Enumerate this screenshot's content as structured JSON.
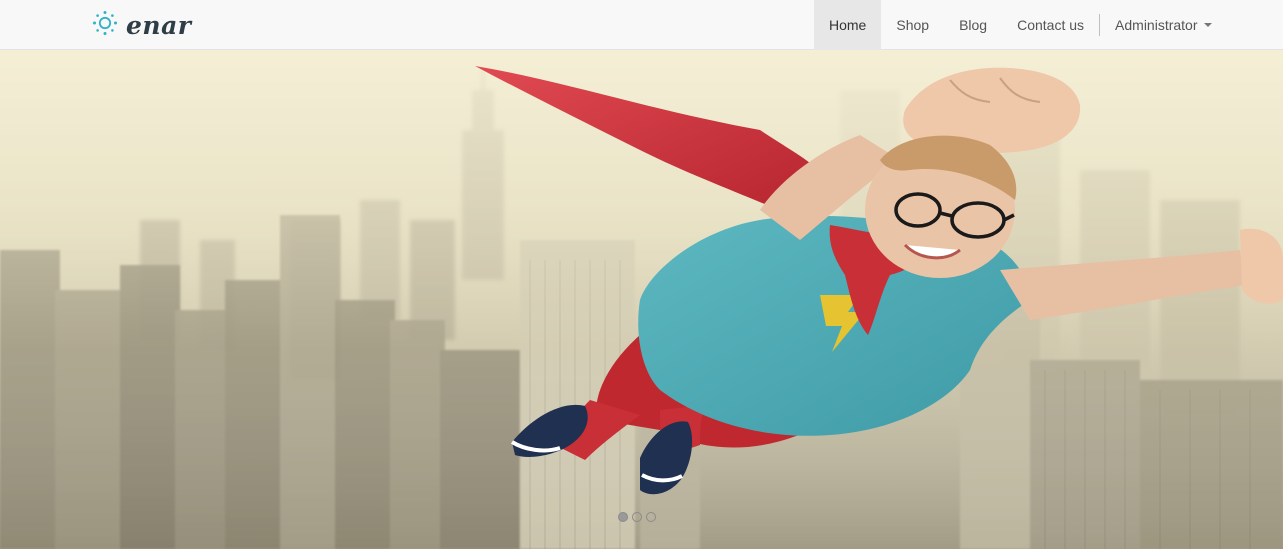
{
  "brand": {
    "name": "enar",
    "icon": "sun-icon",
    "color": "#2fb3c7"
  },
  "nav": {
    "items": [
      {
        "label": "Home",
        "active": true
      },
      {
        "label": "Shop",
        "active": false
      },
      {
        "label": "Blog",
        "active": false
      },
      {
        "label": "Contact us",
        "active": false
      }
    ],
    "user_menu": {
      "label": "Administrator",
      "icon": "caret-down-icon"
    }
  },
  "carousel": {
    "slide_count": 3,
    "active_index": 0,
    "image_subject": "hero-image"
  }
}
